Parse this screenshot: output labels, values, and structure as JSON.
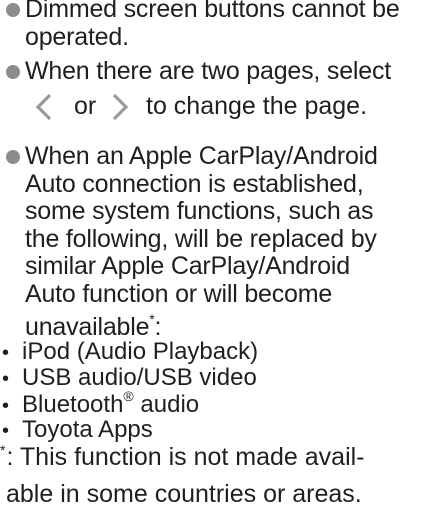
{
  "bullets": [
    {
      "lines": [
        "Dimmed screen buttons cannot be",
        "operated."
      ]
    },
    {
      "lines": [
        "When there are two pages, select"
      ],
      "nav": {
        "prev_icon": "chevron-left-icon",
        "or_text": "or",
        "next_icon": "chevron-right-icon",
        "after_text": "to change the page."
      }
    },
    {
      "lines": [
        "When an Apple CarPlay/Android",
        "Auto connection is established,",
        "some system functions, such as",
        "the following, will be replaced by",
        "similar Apple CarPlay/Android",
        "Auto function or will become",
        "unavailable"
      ],
      "footnote_ref": "*",
      "trailing": ":"
    }
  ],
  "sub_items": [
    {
      "bullet": "•",
      "text": "iPod (Audio Playback)"
    },
    {
      "bullet": "•",
      "text": "USB audio/USB video"
    },
    {
      "bullet": "•",
      "text": "Bluetooth",
      "sup": "®",
      "text_after": " audio"
    },
    {
      "bullet": "•",
      "text": "Toyota Apps"
    }
  ],
  "footnote": {
    "mark": "*",
    "lines": [
      ": This function is not made avail-",
      "able in some countries or areas."
    ]
  },
  "colors": {
    "text": "#1f1f1f",
    "bullet_dot": "#8c8c8c",
    "chevron": "#9a9a9a"
  }
}
